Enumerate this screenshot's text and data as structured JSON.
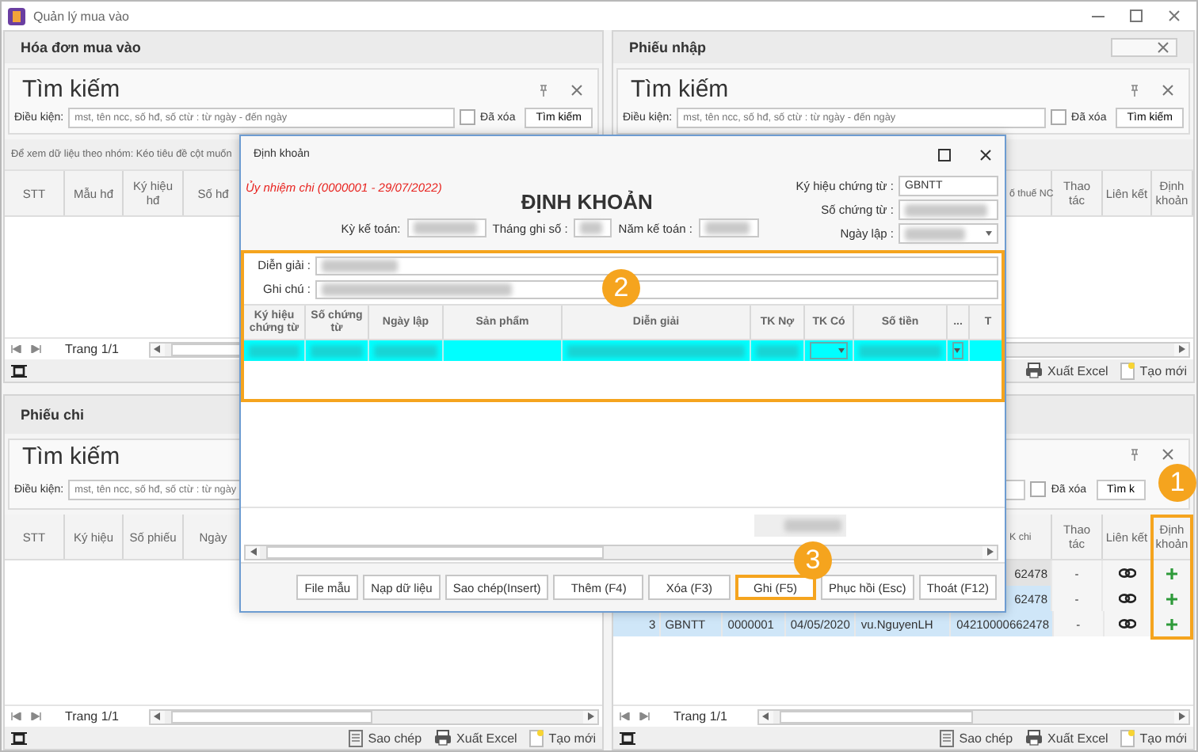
{
  "app": {
    "title": "Quản lý mua vào"
  },
  "panels": [
    {
      "title": "Hóa đơn mua vào",
      "closable": false,
      "search": {
        "title": "Tìm kiếm",
        "pin_close": true,
        "label": "Điều kiện:",
        "placeholder": "mst, tên ncc, số hđ, số ctừ : từ ngày - đến ngày",
        "deleted": {
          "label": "Đã xóa",
          "checked": false
        },
        "button": "Tìm kiếm"
      },
      "group_bar": true,
      "group_hint": "Để xem dữ liệu theo nhóm: Kéo tiêu đề cột muốn",
      "columns": [
        {
          "label": "STT"
        },
        {
          "label": "Mẫu hđ"
        },
        {
          "label": "Ký hiệu hđ"
        },
        {
          "label": "Số hđ"
        }
      ],
      "pager": "Trang 1/1",
      "fit_button": true
    },
    {
      "title": "Phiếu nhập",
      "closable": true,
      "search": {
        "title": "Tìm kiếm",
        "pin_close": true,
        "label": "Điều kiện:",
        "placeholder": "mst, tên ncc, số hđ, số ctừ : từ ngày - đến ngày",
        "deleted": {
          "label": "Đã xóa",
          "checked": false
        },
        "button": "Tìm kiếm"
      },
      "group_bar": true,
      "columns": [
        {
          "label": "ố thuế NC"
        },
        {
          "label": "Thao tác"
        },
        {
          "label": "Liên kết"
        },
        {
          "label": "Định khoản",
          "highlighted": false
        }
      ],
      "fit_button": false,
      "actions": [
        {
          "kind": "excel",
          "label": "Xuất Excel"
        },
        {
          "kind": "new",
          "label": "Tạo mới"
        }
      ]
    },
    {
      "title": "Phiếu chi",
      "closable": false,
      "search": {
        "title": "Tìm kiếm",
        "label": "Điều kiện:",
        "placeholder": "mst, tên ncc, số hđ, số ctừ : từ ngày"
      },
      "group_bar": false,
      "columns": [
        {
          "label": "STT"
        },
        {
          "label": "Ký hiệu"
        },
        {
          "label": "Số phiếu"
        },
        {
          "label": "Ngày"
        }
      ],
      "pager": "Trang 1/1",
      "fit_button": true,
      "actions": [
        {
          "kind": "copy",
          "label": "Sao chép"
        },
        {
          "kind": "excel",
          "label": "Xuất Excel"
        },
        {
          "kind": "new",
          "label": "Tạo mới"
        }
      ]
    },
    {
      "closable": false,
      "search": {
        "pin_close": true,
        "deleted": {
          "label": "Đã xóa",
          "checked": false
        },
        "button": "Tìm k"
      },
      "group_bar": false,
      "columns": [
        {
          "label": "K chi"
        },
        {
          "label": "Thao tác"
        },
        {
          "label": "Liên kết"
        },
        {
          "label": "Định khoản",
          "highlighted": true
        }
      ],
      "rows": [
        {
          "values": [
            "62478"
          ],
          "action": "-",
          "focused": true,
          "selected": false
        },
        {
          "values": [
            "62478"
          ],
          "action": "-",
          "focused": false,
          "selected": true
        },
        {
          "values": [
            "3",
            "GBNTT",
            "0000001",
            "04/05/2020",
            "vu.NguyenLH",
            "04210000662478"
          ],
          "action": "-",
          "focused": false,
          "selected": true
        }
      ],
      "pager": "Trang 1/1",
      "fit_button": true,
      "actions": [
        {
          "kind": "copy",
          "label": "Sao chép"
        },
        {
          "kind": "excel",
          "label": "Xuất Excel"
        },
        {
          "kind": "new",
          "label": "Tạo mới"
        }
      ]
    }
  ],
  "dialog": {
    "title": "Định khoản",
    "subtitle": "Ủy nhiệm chi (0000001 - 29/07/2022)",
    "heading": "ĐỊNH KHOẢN",
    "period_fields": [
      {
        "label": "Kỳ kế toán:",
        "redacted": true
      },
      {
        "label": "Tháng ghi số :",
        "redacted": true
      },
      {
        "label": "Năm kế toán :",
        "redacted": true
      }
    ],
    "voucher_fields": [
      {
        "label": "Ký hiệu chứng từ :",
        "kind": "text",
        "value": "GBNTT"
      },
      {
        "label": "Số chứng từ :",
        "kind": "text",
        "redacted": true
      },
      {
        "label": "Ngày lập :",
        "kind": "dropdown",
        "redacted": true
      }
    ],
    "entry_section": {
      "highlighted": true,
      "notes": [
        {
          "label": "Diễn giải :",
          "redacted": true
        },
        {
          "label": "Ghi chú :",
          "redacted": true
        }
      ],
      "columns": [
        "Ký hiệu chứng từ",
        "Số chứng từ",
        "Ngày lập",
        "Sản phẩm",
        "Diễn giải",
        "TK Nợ",
        "TK Có",
        "Số tiền",
        "...",
        "T"
      ],
      "rows": [
        {
          "selected": true,
          "cells": [
            {
              "kind": "redacted"
            },
            {
              "kind": "redacted"
            },
            {
              "kind": "redacted"
            },
            {
              "kind": "empty"
            },
            {
              "kind": "redacted"
            },
            {
              "kind": "redacted"
            },
            {
              "kind": "dropdown"
            },
            {
              "kind": "redacted"
            },
            {
              "kind": "dropdown"
            },
            {
              "kind": "empty"
            }
          ]
        }
      ]
    },
    "total": {
      "redacted": true
    },
    "buttons": [
      {
        "label": "File mẫu",
        "highlighted": false
      },
      {
        "label": "Nạp dữ liệu",
        "highlighted": false
      },
      {
        "label": "Sao chép(Insert)",
        "highlighted": false
      },
      {
        "label": "Thêm (F4)",
        "highlighted": false
      },
      {
        "label": "Xóa (F3)",
        "highlighted": false
      },
      {
        "label": "Ghi (F5)",
        "highlighted": true
      },
      {
        "label": "Phục hồi (Esc)",
        "highlighted": false
      },
      {
        "label": "Thoát (F12)",
        "highlighted": false
      }
    ]
  },
  "callouts": [
    {
      "number": "1"
    },
    {
      "number": "2"
    },
    {
      "number": "3"
    }
  ]
}
